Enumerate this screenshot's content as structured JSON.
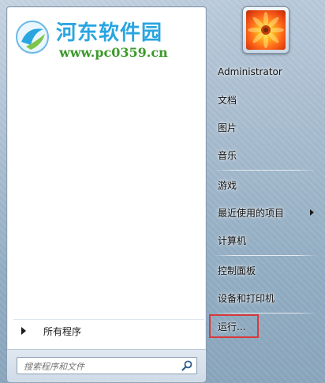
{
  "watermark": {
    "title": "河东软件园",
    "url": "www.pc0359.cn"
  },
  "left": {
    "all_programs_label": "所有程序",
    "search_placeholder": "搜索程序和文件"
  },
  "right": {
    "user_name": "Administrator",
    "items": [
      {
        "label": "文档"
      },
      {
        "label": "图片"
      },
      {
        "label": "音乐"
      },
      {
        "label": "游戏"
      },
      {
        "label": "最近使用的项目",
        "has_submenu": true
      },
      {
        "label": "计算机"
      },
      {
        "label": "控制面板"
      },
      {
        "label": "设备和打印机"
      },
      {
        "label": "运行...",
        "highlighted": true
      }
    ]
  },
  "colors": {
    "highlight_box": "#d93a3a",
    "watermark_title": "#2aa5e0",
    "watermark_url": "#3c9a2a"
  },
  "icons": {
    "watermark_logo": "site-logo-icon",
    "search": "magnifier-icon",
    "avatar": "flower-picture",
    "submenu": "chevron-right-icon",
    "all_programs": "chevron-right-icon"
  }
}
